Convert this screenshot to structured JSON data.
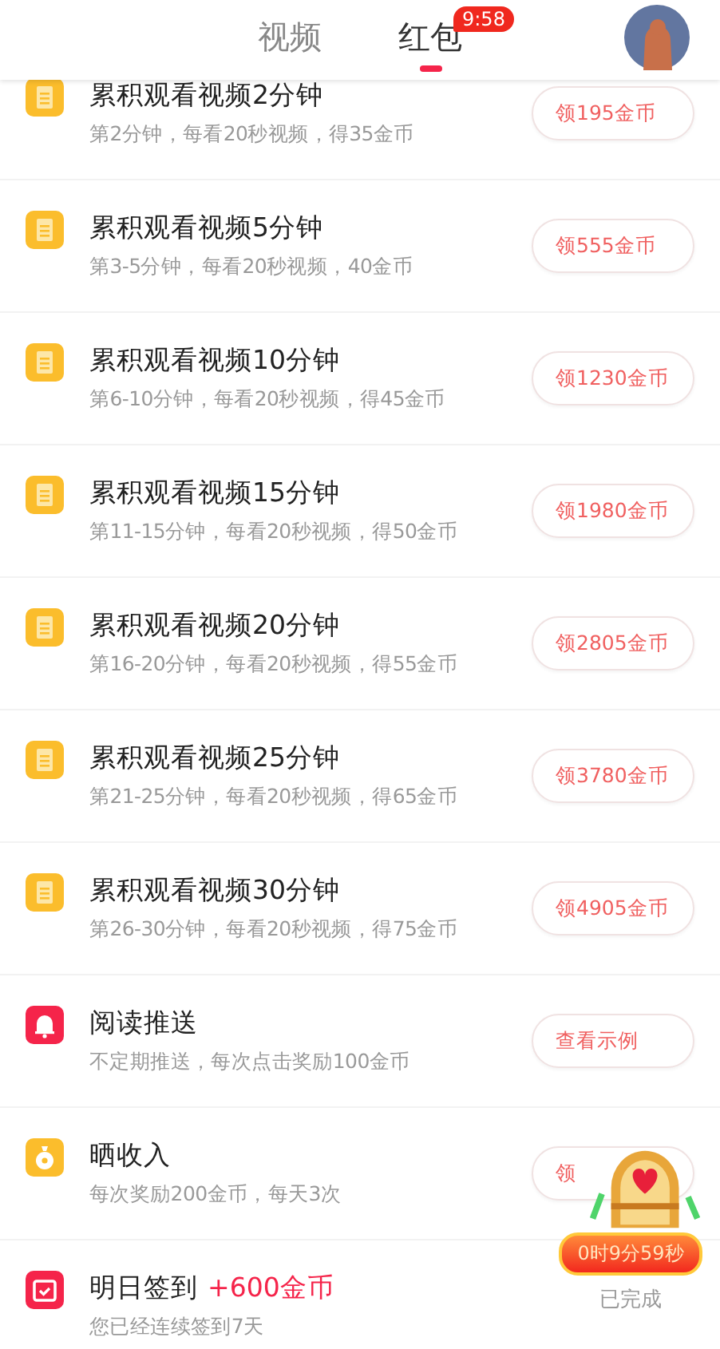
{
  "header": {
    "tabs": [
      {
        "label": "视频",
        "selected": false
      },
      {
        "label": "红包",
        "selected": true,
        "badge": "9:58"
      }
    ]
  },
  "tasks": [
    {
      "kind": "doc",
      "title": "累积观看视频2分钟",
      "subtitle": "第2分钟，每看20秒视频，得35金币",
      "button": "领195金币"
    },
    {
      "kind": "doc",
      "title": "累积观看视频5分钟",
      "subtitle": "第3-5分钟，每看20秒视频，40金币",
      "button": "领555金币"
    },
    {
      "kind": "doc",
      "title": "累积观看视频10分钟",
      "subtitle": "第6-10分钟，每看20秒视频，得45金币",
      "button": "领1230金币"
    },
    {
      "kind": "doc",
      "title": "累积观看视频15分钟",
      "subtitle": "第11-15分钟，每看20秒视频，得50金币",
      "button": "领1980金币"
    },
    {
      "kind": "doc",
      "title": "累积观看视频20分钟",
      "subtitle": "第16-20分钟，每看20秒视频，得55金币",
      "button": "领2805金币"
    },
    {
      "kind": "doc",
      "title": "累积观看视频25分钟",
      "subtitle": "第21-25分钟，每看20秒视频，得65金币",
      "button": "领3780金币"
    },
    {
      "kind": "doc",
      "title": "累积观看视频30分钟",
      "subtitle": "第26-30分钟，每看20秒视频，得75金币",
      "button": "领4905金币"
    },
    {
      "kind": "bell",
      "title": "阅读推送",
      "subtitle": "不定期推送，每次点击奖励100金币",
      "button": "查看示例"
    },
    {
      "kind": "moneybag",
      "title": "晒收入",
      "subtitle": "每次奖励200金币，每天3次",
      "button": "领"
    },
    {
      "kind": "calendar",
      "title": "明日签到",
      "bonus": "+600金币",
      "subtitle": "您已经连续签到7天"
    }
  ],
  "chest": {
    "timer": "0时9分59秒",
    "status": "已完成"
  }
}
